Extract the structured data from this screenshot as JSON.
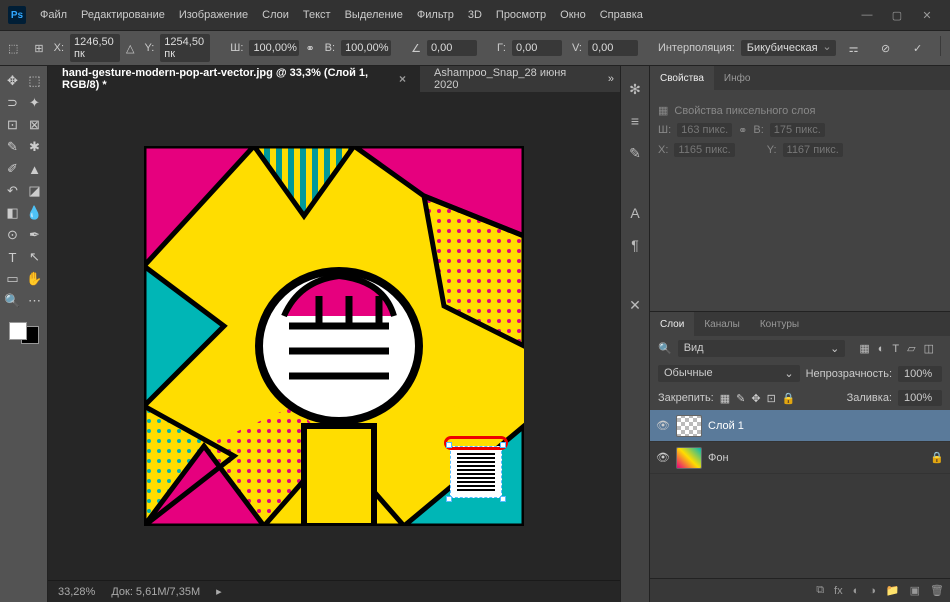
{
  "app": {
    "logo": "Ps"
  },
  "menu": {
    "file": "Файл",
    "edit": "Редактирование",
    "image": "Изображение",
    "layers": "Слои",
    "type": "Текст",
    "select": "Выделение",
    "filter": "Фильтр",
    "threed": "3D",
    "view": "Просмотр",
    "window": "Окно",
    "help": "Справка"
  },
  "options": {
    "x_label": "X:",
    "x_val": "1246,50 пк",
    "y_label": "Y:",
    "y_val": "1254,50 пк",
    "w_label": "Ш:",
    "w_val": "100,00%",
    "h_label": "В:",
    "h_val": "100,00%",
    "angle_label": "∠",
    "angle_val": "0,00",
    "hskew_label": "Г:",
    "hskew_val": "0,00",
    "vskew_label": "V:",
    "vskew_val": "0,00",
    "interp_label": "Интерполяция:",
    "interp_val": "Бикубическая"
  },
  "tabs": {
    "active": "hand-gesture-modern-pop-art-vector.jpg @ 33,3% (Слой 1, RGB/8) *",
    "inactive": "Ashampoo_Snap_28 июня 2020"
  },
  "status": {
    "zoom": "33,28%",
    "doc": "Док: 5,61M/7,35M"
  },
  "panels": {
    "props_tab": "Свойства",
    "info_tab": "Инфо",
    "props_title": "Свойства пиксельного слоя",
    "w_label": "Ш:",
    "w_val": "163 пикс.",
    "h_label": "В:",
    "h_val": "175 пикс.",
    "x_label": "X:",
    "x_val": "1165 пикс.",
    "y_label": "Y:",
    "y_val": "1167 пикс."
  },
  "layers": {
    "tab_layers": "Слои",
    "tab_channels": "Каналы",
    "tab_paths": "Контуры",
    "filter_label": "Вид",
    "blend": "Обычные",
    "opacity_label": "Непрозрачность:",
    "opacity_val": "100%",
    "lock_label": "Закрепить:",
    "fill_label": "Заливка:",
    "fill_val": "100%",
    "layer1": "Слой 1",
    "bg": "Фон"
  },
  "icons": {
    "search": "🔍",
    "link": "⚭",
    "checkmark": "✓",
    "cancel": "⊘",
    "share": "⇪",
    "gear": "✻",
    "align": "≡",
    "brush": "✎",
    "type_A": "A",
    "swap": "✕",
    "eye": "👁",
    "lock": "🔒",
    "trash": "🗑",
    "folder": "📁",
    "fx": "fx",
    "mask": "◐",
    "new": "▣",
    "adjust": "◑",
    "link2": "⧉"
  }
}
